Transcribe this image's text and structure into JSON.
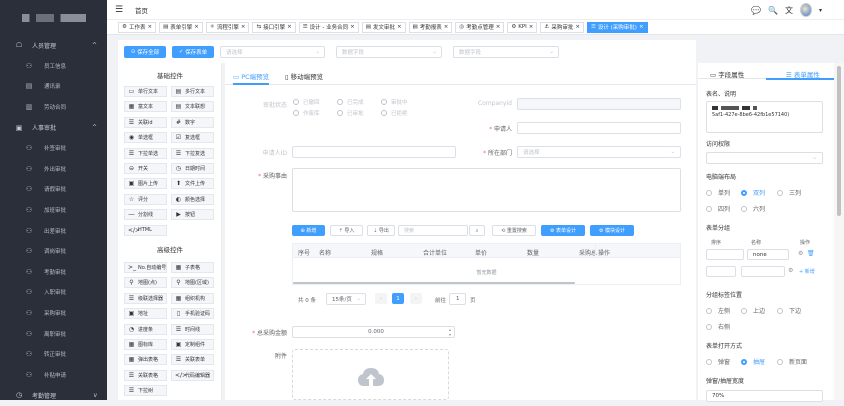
{
  "sidebar": {
    "items": [
      {
        "label": "人员管理",
        "icon": "user-group-icon",
        "level": 0,
        "arrow": "^"
      },
      {
        "label": "员工信息",
        "icon": "person-icon",
        "level": 1
      },
      {
        "label": "通讯录",
        "icon": "contacts-icon",
        "level": 1
      },
      {
        "label": "劳动合同",
        "icon": "contract-icon",
        "level": 1
      },
      {
        "label": "人事审批",
        "icon": "approval-icon",
        "level": 0,
        "arrow": "^"
      },
      {
        "label": "补签审批",
        "icon": "person-icon",
        "level": 1
      },
      {
        "label": "外出审批",
        "icon": "person-icon",
        "level": 1
      },
      {
        "label": "请假审批",
        "icon": "person-icon",
        "level": 1
      },
      {
        "label": "加班审批",
        "icon": "person-icon",
        "level": 1
      },
      {
        "label": "出差审批",
        "icon": "person-icon",
        "level": 1
      },
      {
        "label": "调岗审批",
        "icon": "person-icon",
        "level": 1
      },
      {
        "label": "考勤审批",
        "icon": "person-icon",
        "level": 1
      },
      {
        "label": "入职审批",
        "icon": "person-icon",
        "level": 1
      },
      {
        "label": "采购审批",
        "icon": "person-icon",
        "level": 1
      },
      {
        "label": "离职审批",
        "icon": "person-icon",
        "level": 1
      },
      {
        "label": "转正审批",
        "icon": "person-icon",
        "level": 1
      },
      {
        "label": "补贴申请",
        "icon": "person-icon",
        "level": 1
      },
      {
        "label": "考勤管理",
        "icon": "clock-icon",
        "level": 0,
        "arrow": "v"
      }
    ]
  },
  "topbar": {
    "title": "首页"
  },
  "tabs": [
    {
      "label": "工作表",
      "icon": "⚙",
      "active": false
    },
    {
      "label": "表单引擎",
      "icon": "▤",
      "active": false
    },
    {
      "label": "流程引擎",
      "icon": "⚛",
      "active": false
    },
    {
      "label": "接口引擎",
      "icon": "⇆",
      "active": false
    },
    {
      "label": "设计 - 业务合同",
      "icon": "☰",
      "active": false
    },
    {
      "label": "发文审批",
      "icon": "▤",
      "active": false
    },
    {
      "label": "考勤报表",
      "icon": "▤",
      "active": false
    },
    {
      "label": "考勤点管理",
      "icon": "◎",
      "active": false
    },
    {
      "label": "KPI",
      "icon": "⚙",
      "active": false
    },
    {
      "label": "采购审批",
      "icon": "⚓",
      "active": false
    },
    {
      "label": "设计 (采购审批)",
      "icon": "☰",
      "active": true
    }
  ],
  "toolbar": {
    "save_all": "保存全部",
    "save_form": "保存表单",
    "select_placeholders": [
      "请选择",
      "数据字段",
      "数据字段"
    ]
  },
  "widgets": {
    "basic_title": "基础控件",
    "basic": [
      {
        "label": "单行文本",
        "icon": "▭"
      },
      {
        "label": "多行文本",
        "icon": "▤"
      },
      {
        "label": "富文本",
        "icon": "▦"
      },
      {
        "label": "文本联想",
        "icon": "▤"
      },
      {
        "label": "关联id",
        "icon": "☰"
      },
      {
        "label": "数字",
        "icon": "#"
      },
      {
        "label": "单选框",
        "icon": "◉"
      },
      {
        "label": "复选框",
        "icon": "☑"
      },
      {
        "label": "下拉单选",
        "icon": "☰"
      },
      {
        "label": "下拉复选",
        "icon": "☰"
      },
      {
        "label": "开关",
        "icon": "⊖"
      },
      {
        "label": "日期时间",
        "icon": "◷"
      },
      {
        "label": "图片上传",
        "icon": "▣"
      },
      {
        "label": "文件上传",
        "icon": "⬆"
      },
      {
        "label": "评分",
        "icon": "☆"
      },
      {
        "label": "颜色选择",
        "icon": "◐"
      },
      {
        "label": "分割线",
        "icon": "―"
      },
      {
        "label": "按钮",
        "icon": "▶"
      },
      {
        "label": "HTML",
        "icon": "</>"
      }
    ],
    "advanced_title": "高级控件",
    "advanced": [
      {
        "label": "No.自动编号",
        "icon": ">_"
      },
      {
        "label": "子表格",
        "icon": "▦"
      },
      {
        "label": "地图(点)",
        "icon": "⚲"
      },
      {
        "label": "地图(区域)",
        "icon": "⚲"
      },
      {
        "label": "级联选择器",
        "icon": "☰"
      },
      {
        "label": "组织机构",
        "icon": "▦"
      },
      {
        "label": "地址",
        "icon": "▣"
      },
      {
        "label": "手机验证码",
        "icon": "▯"
      },
      {
        "label": "进度条",
        "icon": "◔"
      },
      {
        "label": "时间线",
        "icon": "☰"
      },
      {
        "label": "图标库",
        "icon": "▦"
      },
      {
        "label": "定制组件",
        "icon": "▣"
      },
      {
        "label": "弹出表格",
        "icon": "▦"
      },
      {
        "label": "关联表单",
        "icon": "☰"
      },
      {
        "label": "关联表格",
        "icon": "☰"
      },
      {
        "label": "代码编辑器",
        "icon": "</>"
      },
      {
        "label": "下拉树",
        "icon": "☰"
      }
    ]
  },
  "canvas": {
    "tabs": [
      {
        "label": "PC端预览",
        "icon": "▭",
        "active": true
      },
      {
        "label": "移动端预览",
        "icon": "▯",
        "active": false
      }
    ],
    "fields": {
      "status_label": "审批状态",
      "status_options": [
        "已撤回",
        "已完成",
        "审批中",
        "作废库",
        "已审批",
        "已拒绝"
      ],
      "company_label": "Companyid",
      "applicant_label": "申请人",
      "applicant_input_label": "申请人ID",
      "dept_label": "所在部门",
      "dept_placeholder": "请选择",
      "reason_label": "采购事由",
      "total_label": "总采购金额",
      "total_value": "0.000",
      "attachment_label": "附件"
    },
    "table_toolbar": {
      "add": "新增",
      "import": "导入",
      "export": "导出",
      "search_placeholder": "搜索",
      "reset": "重置搜索",
      "form_design": "表单设计",
      "module_design": "模块设计"
    },
    "table": {
      "columns": [
        "序号",
        "名称",
        "规格",
        "合计单位",
        "单价",
        "数量",
        "采购总",
        "操作"
      ],
      "empty_text": "暂无数据"
    },
    "pager": {
      "total": "共 0 条",
      "page_size": "15条/页",
      "current_page": "1",
      "goto_label": "前往",
      "goto_value": "1",
      "page_suffix": "页"
    }
  },
  "props": {
    "tabs": [
      {
        "label": "字段属性",
        "icon": "▭",
        "active": false
      },
      {
        "label": "表单属性",
        "icon": "☰",
        "active": true
      }
    ],
    "form_name_label": "表名、说明",
    "form_name_value": "5af1-427e-8be6-42fb1e57140)",
    "access_label": "访问权限",
    "layout_label": "电脑端布局",
    "layout_options": [
      "单列",
      "双列",
      "三列",
      "四列",
      "六列"
    ],
    "layout_selected": "双列",
    "group_label": "表单分组",
    "group_columns": [
      "排序",
      "名称",
      "操作"
    ],
    "group_row_name": "none",
    "group_add": "新增",
    "tab_pos_label": "分组标签位置",
    "tab_pos_options": [
      "左侧",
      "上边",
      "下边",
      "右侧"
    ],
    "open_mode_label": "表单打开方式",
    "open_mode_options": [
      "弹窗",
      "抽屉",
      "新页面"
    ],
    "open_mode_selected": "抽屉",
    "width_label": "弹窗/抽屉宽度",
    "width_value": "70%"
  },
  "colors": {
    "accent": "#409eff",
    "sidebar_bg": "#2b2f3a"
  }
}
